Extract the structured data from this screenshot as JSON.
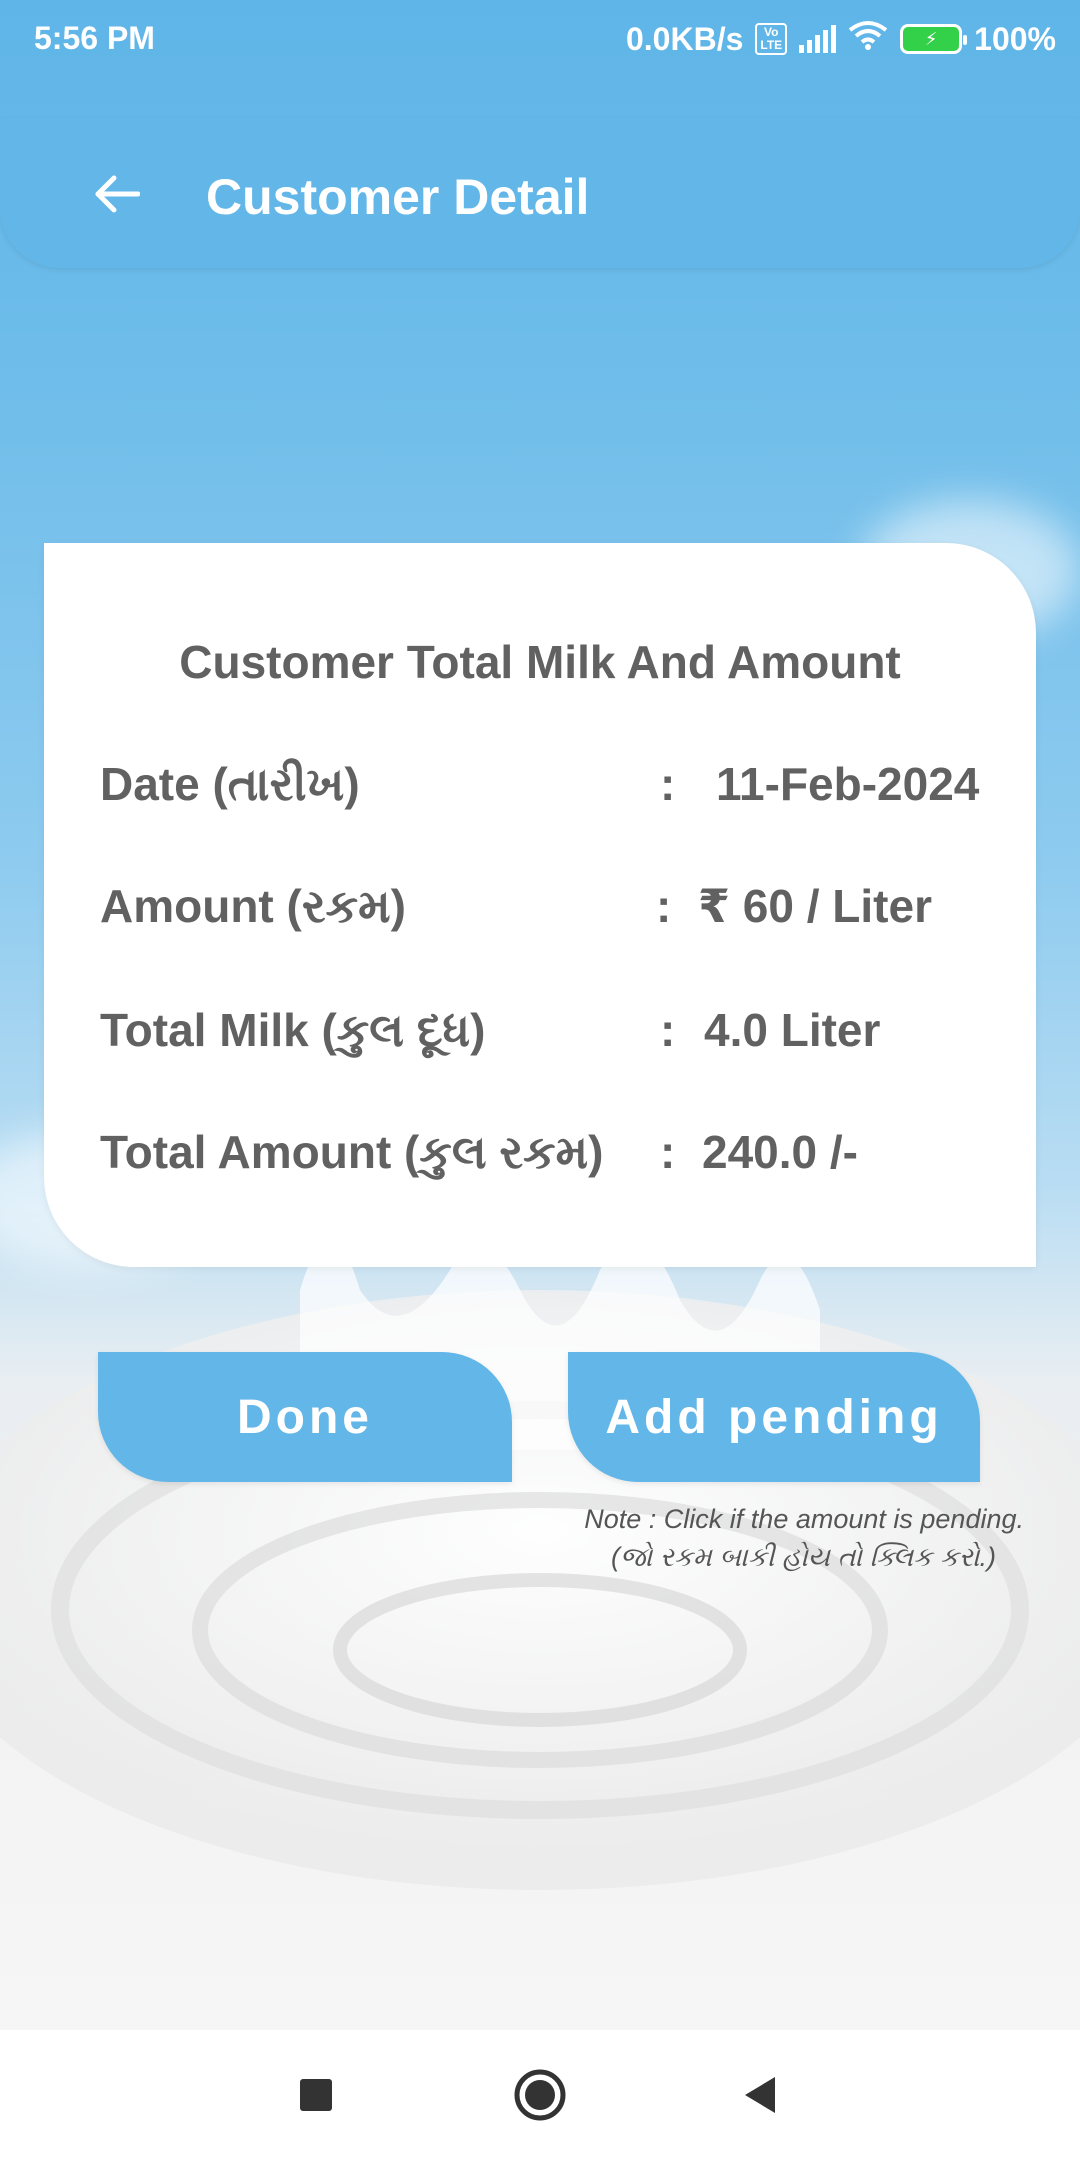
{
  "status_bar": {
    "time": "5:56 PM",
    "network_speed": "0.0KB/s",
    "volte": "Vo LTE",
    "battery": "100%",
    "battery_color": "#33d14a"
  },
  "app_bar": {
    "title": "Customer Detail",
    "back_icon": "arrow-left-icon",
    "background": "#62b6e8"
  },
  "card": {
    "title": "Customer Total Milk And Amount",
    "rows": [
      {
        "label": "Date (તારીખ)",
        "colon": ":",
        "value": "11-Feb-2024"
      },
      {
        "label": "Amount (રકમ)",
        "colon": ":",
        "value": "₹ 60 / Liter"
      },
      {
        "label": "Total Milk (કુલ દૂધ)",
        "colon": ":",
        "value": "4.0 Liter"
      },
      {
        "label": "Total Amount (કુલ રકમ)",
        "colon": ":",
        "value": "240.0 /-"
      }
    ]
  },
  "buttons": {
    "done": "Done",
    "add_pending": "Add pending"
  },
  "note": {
    "line1": "Note : Click if the amount is pending.",
    "line2": "(જો રકમ બાકી હોય તો ક્લિક કરો.)"
  },
  "nav_bar": {
    "recents_icon": "square-icon",
    "home_icon": "circle-icon",
    "back_icon": "triangle-back-icon"
  }
}
